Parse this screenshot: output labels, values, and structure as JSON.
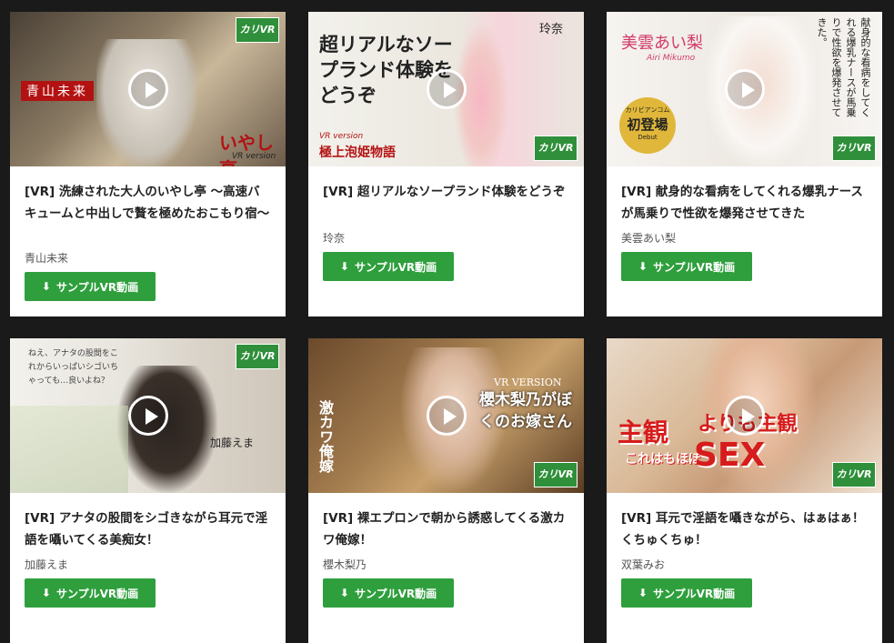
{
  "cards": [
    {
      "title": "[VR] 洗練された大人のいやし亭 ～高速バキュームと中出しで贅を極めたおこもり宿～",
      "actress": "青山未来",
      "button_label": "サンプルVR動画",
      "thumb": {
        "name_text": "青山未来",
        "logo_text": "いやし亭",
        "sub_text": "VR version"
      }
    },
    {
      "title": "[VR] 超リアルなソープランド体験をどうぞ",
      "actress": "玲奈",
      "button_label": "サンプルVR動画",
      "thumb": {
        "headline": "超リアルなソープランド体験をどうぞ",
        "name_text": "玲奈",
        "sub_text": "VR version",
        "series": "極上泡姫物語"
      }
    },
    {
      "title": "[VR] 献身的な看病をしてくれる爆乳ナースが馬乗りで性欲を爆発させてきた",
      "actress": "美雲あい梨",
      "button_label": "サンプルVR動画",
      "thumb": {
        "name_text": "美雲あい梨",
        "romaji": "Airi Mikumo",
        "badge": "初登場",
        "badge_top": "カリビアンコム",
        "badge_sub": "Debut",
        "vertical": "献身的な看病をしてくれる爆乳ナースが馬乗りで性欲を爆発させてきた。"
      }
    },
    {
      "title": "[VR] アナタの股間をシゴきながら耳元で淫語を囁いてくる美痴女！",
      "actress": "加藤えま",
      "button_label": "サンプルVR動画",
      "thumb": {
        "speech": "ねえ、アナタの股間をこれからいっぱいシゴいちゃっても…良いよね？",
        "name_text": "加藤えま"
      }
    },
    {
      "title": "[VR] 裸エプロンで朝から誘惑してくる激カワ俺嫁！",
      "actress": "櫻木梨乃",
      "button_label": "サンプルVR動画",
      "thumb": {
        "headline": "櫻木梨乃がぼくのお嫁さん",
        "sub_text": "VR VERSION",
        "vertical": "激カワ俺嫁"
      }
    },
    {
      "title": "[VR] 耳元で淫語を囁きながら、はぁはぁ！くちゅくちゅ！",
      "actress": "双葉みお",
      "button_label": "サンプルVR動画",
      "thumb": {
        "red_text": "主観",
        "red_text2": "よりも主観",
        "sex_text": "SEX",
        "small_text": "これはもほぼ"
      }
    }
  ],
  "vr_badge_label": "カリVR",
  "icons": {
    "play": "play-icon",
    "download": "download-icon"
  },
  "colors": {
    "background": "#1a1a1a",
    "button": "#2e9f3c",
    "badge": "#2f8f3a"
  }
}
